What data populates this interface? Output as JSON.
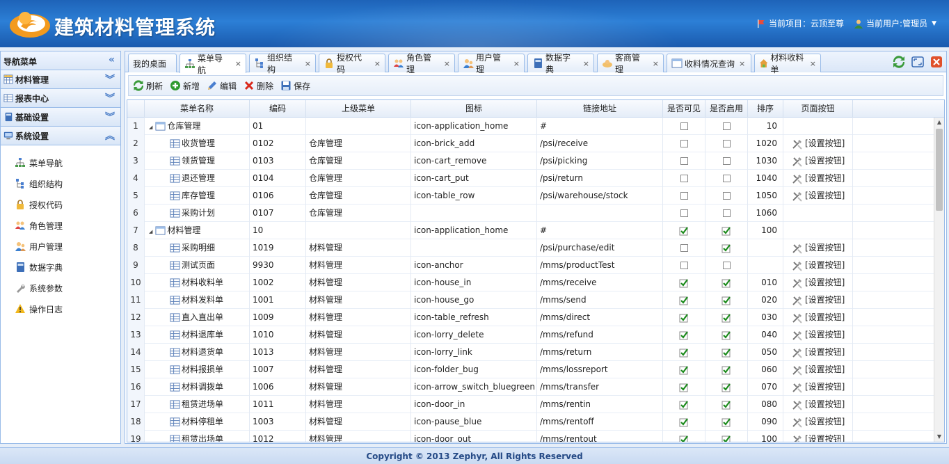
{
  "header": {
    "app_title": "建筑材料管理系统",
    "project_label": "当前项目：云顶至尊",
    "user_label": "当前用户:管理员"
  },
  "left": {
    "title": "导航菜单",
    "groups": [
      {
        "label": "材料管理",
        "icon": "grid-icon"
      },
      {
        "label": "报表中心",
        "icon": "table-icon"
      },
      {
        "label": "基础设置",
        "icon": "book-icon"
      },
      {
        "label": "系统设置",
        "icon": "monitor-icon"
      }
    ],
    "items": [
      {
        "label": "菜单导航",
        "icon": "sitemap-icon"
      },
      {
        "label": "组织结构",
        "icon": "org-icon"
      },
      {
        "label": "授权代码",
        "icon": "lock-icon"
      },
      {
        "label": "角色管理",
        "icon": "users-icon"
      },
      {
        "label": "用户管理",
        "icon": "user-icon"
      },
      {
        "label": "数据字典",
        "icon": "book-icon"
      },
      {
        "label": "系统参数",
        "icon": "wrench-icon"
      },
      {
        "label": "操作日志",
        "icon": "warning-icon"
      }
    ]
  },
  "tabs": [
    {
      "label": "我的桌面",
      "icon": "",
      "closable": false
    },
    {
      "label": "菜单导航",
      "icon": "sitemap-icon",
      "closable": true,
      "active": true
    },
    {
      "label": "组织结构",
      "icon": "org-icon",
      "closable": true
    },
    {
      "label": "授权代码",
      "icon": "lock-icon",
      "closable": true
    },
    {
      "label": "角色管理",
      "icon": "users-icon",
      "closable": true
    },
    {
      "label": "用户管理",
      "icon": "user-icon",
      "closable": true
    },
    {
      "label": "数据字典",
      "icon": "book-icon",
      "closable": true
    },
    {
      "label": "客商管理",
      "icon": "merchant-icon",
      "closable": true
    },
    {
      "label": "收料情况查询",
      "icon": "window-icon",
      "closable": true
    },
    {
      "label": "材料收料单",
      "icon": "house-icon",
      "closable": true
    }
  ],
  "tab_close_glyph": "×",
  "toolbar": {
    "refresh": "刷新",
    "add": "新增",
    "edit": "编辑",
    "delete": "删除",
    "save": "保存"
  },
  "grid": {
    "columns": [
      "菜单名称",
      "编码",
      "上级菜单",
      "图标",
      "链接地址",
      "是否可见",
      "是否启用",
      "排序",
      "页面按钮"
    ],
    "button_label": "[设置按钮]",
    "rows": [
      {
        "n": "1",
        "name": "仓库管理",
        "tree": true,
        "code": "01",
        "parent": "",
        "icon": "icon-application_home",
        "url": "#",
        "visible": false,
        "enabled": false,
        "sort": "10",
        "btn": false
      },
      {
        "n": "2",
        "name": "收货管理",
        "code": "0102",
        "parent": "仓库管理",
        "icon": "icon-brick_add",
        "url": "/psi/receive",
        "visible": false,
        "enabled": false,
        "sort": "1020",
        "btn": true
      },
      {
        "n": "3",
        "name": "领货管理",
        "code": "0103",
        "parent": "仓库管理",
        "icon": "icon-cart_remove",
        "url": "/psi/picking",
        "visible": false,
        "enabled": false,
        "sort": "1030",
        "btn": true
      },
      {
        "n": "4",
        "name": "退还管理",
        "code": "0104",
        "parent": "仓库管理",
        "icon": "icon-cart_put",
        "url": "/psi/return",
        "visible": false,
        "enabled": false,
        "sort": "1040",
        "btn": true
      },
      {
        "n": "5",
        "name": "库存管理",
        "code": "0106",
        "parent": "仓库管理",
        "icon": "icon-table_row",
        "url": "/psi/warehouse/stock",
        "visible": false,
        "enabled": false,
        "sort": "1050",
        "btn": true
      },
      {
        "n": "6",
        "name": "采购计划",
        "code": "0107",
        "parent": "仓库管理",
        "icon": "",
        "url": "",
        "visible": false,
        "enabled": false,
        "sort": "1060",
        "btn": false
      },
      {
        "n": "7",
        "name": "材料管理",
        "tree": true,
        "code": "10",
        "parent": "",
        "icon": "icon-application_home",
        "url": "#",
        "visible": true,
        "enabled": true,
        "sort": "100",
        "btn": false
      },
      {
        "n": "8",
        "name": "采购明细",
        "code": "1019",
        "parent": "材料管理",
        "icon": "",
        "url": "/psi/purchase/edit",
        "visible": false,
        "enabled": true,
        "sort": "",
        "btn": true
      },
      {
        "n": "9",
        "name": "测试页面",
        "code": "9930",
        "parent": "材料管理",
        "icon": "icon-anchor",
        "url": "/mms/productTest",
        "visible": false,
        "enabled": false,
        "sort": "",
        "btn": true
      },
      {
        "n": "10",
        "name": "材料收料单",
        "code": "1002",
        "parent": "材料管理",
        "icon": "icon-house_in",
        "url": "/mms/receive",
        "visible": true,
        "enabled": true,
        "sort": "010",
        "btn": true
      },
      {
        "n": "11",
        "name": "材料发料单",
        "code": "1001",
        "parent": "材料管理",
        "icon": "icon-house_go",
        "url": "/mms/send",
        "visible": true,
        "enabled": true,
        "sort": "020",
        "btn": true
      },
      {
        "n": "12",
        "name": "直入直出单",
        "code": "1009",
        "parent": "材料管理",
        "icon": "icon-table_refresh",
        "url": "/mms/direct",
        "visible": true,
        "enabled": true,
        "sort": "030",
        "btn": true
      },
      {
        "n": "13",
        "name": "材料退库单",
        "code": "1010",
        "parent": "材料管理",
        "icon": "icon-lorry_delete",
        "url": "/mms/refund",
        "visible": true,
        "enabled": true,
        "sort": "040",
        "btn": true
      },
      {
        "n": "14",
        "name": "材料退货单",
        "code": "1013",
        "parent": "材料管理",
        "icon": "icon-lorry_link",
        "url": "/mms/return",
        "visible": true,
        "enabled": true,
        "sort": "050",
        "btn": true
      },
      {
        "n": "15",
        "name": "材料报损单",
        "code": "1007",
        "parent": "材料管理",
        "icon": "icon-folder_bug",
        "url": "/mms/lossreport",
        "visible": true,
        "enabled": true,
        "sort": "060",
        "btn": true
      },
      {
        "n": "16",
        "name": "材料调拨单",
        "code": "1006",
        "parent": "材料管理",
        "icon": "icon-arrow_switch_bluegreen",
        "url": "/mms/transfer",
        "visible": true,
        "enabled": true,
        "sort": "070",
        "btn": true
      },
      {
        "n": "17",
        "name": "租赁进场单",
        "code": "1011",
        "parent": "材料管理",
        "icon": "icon-door_in",
        "url": "/mms/rentin",
        "visible": true,
        "enabled": true,
        "sort": "080",
        "btn": true
      },
      {
        "n": "18",
        "name": "材料停租单",
        "code": "1003",
        "parent": "材料管理",
        "icon": "icon-pause_blue",
        "url": "/mms/rentoff",
        "visible": true,
        "enabled": true,
        "sort": "090",
        "btn": true
      },
      {
        "n": "19",
        "name": "租赁出场单",
        "code": "1012",
        "parent": "材料管理",
        "icon": "icon-door_out",
        "url": "/mms/rentout",
        "visible": true,
        "enabled": true,
        "sort": "100",
        "btn": true
      }
    ]
  },
  "footer": "Copyright © 2013 Zephyr, All Rights Reserved",
  "colors": {
    "header": "#1e63b8",
    "accent": "#99bbe8",
    "check": "#1a8a1a"
  }
}
